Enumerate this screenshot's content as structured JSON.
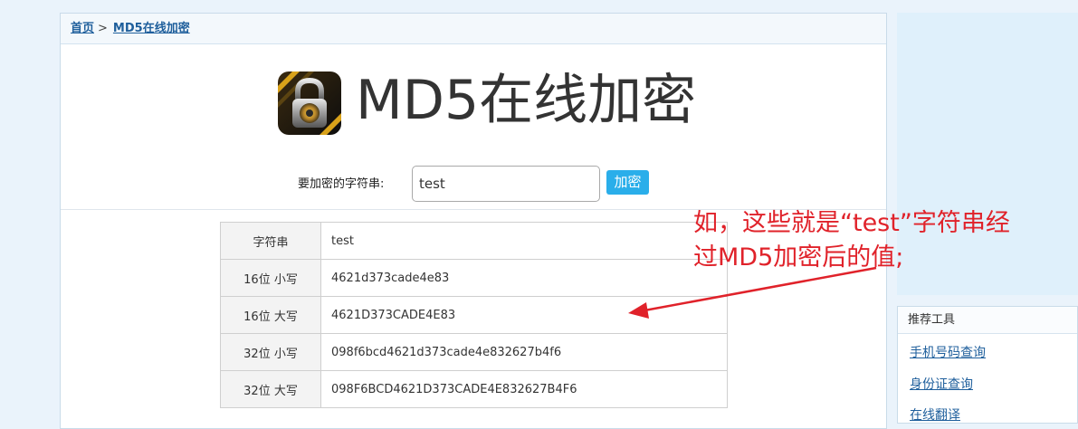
{
  "breadcrumb": {
    "home": "首页",
    "separator": ">",
    "current": "MD5在线加密"
  },
  "hero": {
    "title": "MD5在线加密",
    "logo_icon": "padlock-icon"
  },
  "form": {
    "label": "要加密的字符串:",
    "input_value": "test",
    "button_label": "加密"
  },
  "results": [
    {
      "key": "字符串",
      "value": "test"
    },
    {
      "key": "16位 小写",
      "value": "4621d373cade4e83"
    },
    {
      "key": "16位 大写",
      "value": "4621D373CADE4E83"
    },
    {
      "key": "32位 小写",
      "value": "098f6bcd4621d373cade4e832627b4f6"
    },
    {
      "key": "32位 大写",
      "value": "098F6BCD4621D373CADE4E832627B4F6"
    }
  ],
  "sidebar": {
    "title": "推荐工具",
    "links": [
      "手机号码查询",
      "身份证查询",
      "在线翻译"
    ]
  },
  "annotation": {
    "line1": "如，这些就是“test”字符串经",
    "line2": "过MD5加密后的值;",
    "color": "#e0222a"
  }
}
